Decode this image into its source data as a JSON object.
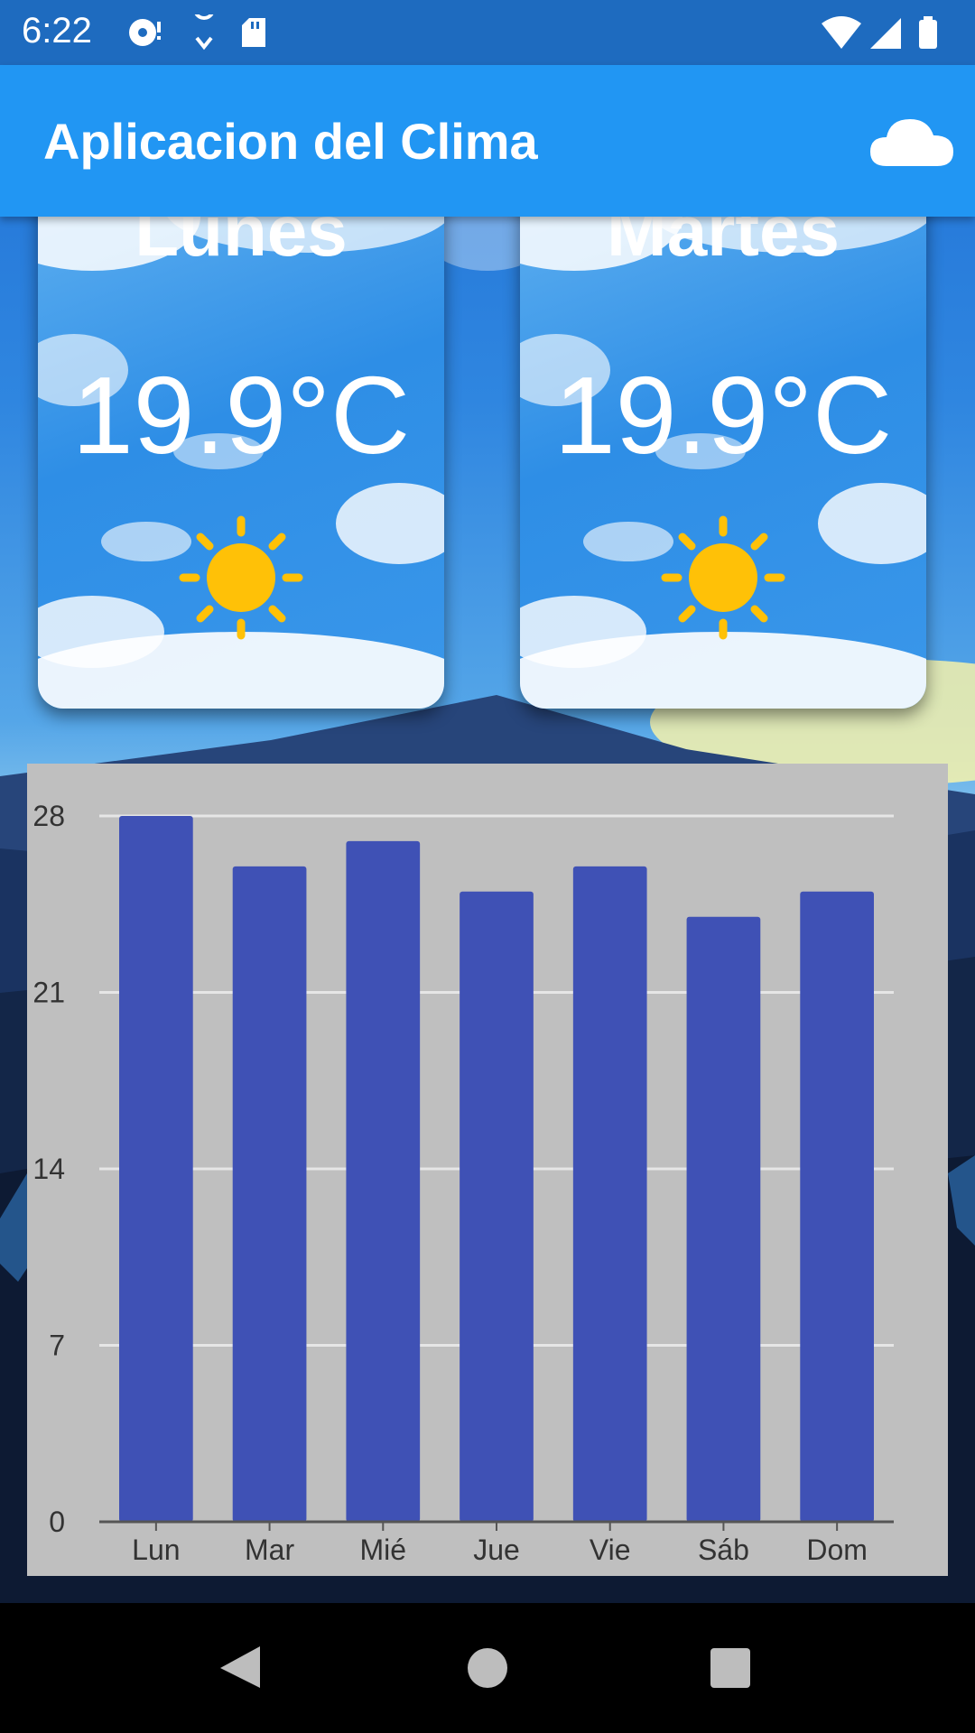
{
  "status_bar": {
    "time": "6:22"
  },
  "app_bar": {
    "title": "Aplicacion del Clima",
    "action_icon": "cloud-icon"
  },
  "cards": [
    {
      "day": "Lunes",
      "temperature": "19.9°C",
      "icon": "sun-icon"
    },
    {
      "day": "Martes",
      "temperature": "19.9°C",
      "icon": "sun-icon"
    }
  ],
  "chart_data": {
    "type": "bar",
    "categories": [
      "Lun",
      "Mar",
      "Mié",
      "Jue",
      "Vie",
      "Sáb",
      "Dom"
    ],
    "values": [
      28,
      26,
      27,
      25,
      26,
      24,
      25
    ],
    "yticks": [
      "0",
      "7",
      "14",
      "21",
      "28"
    ],
    "ylim": [
      0,
      28
    ],
    "grid": true,
    "bar_color": "#3f51b5",
    "title": "",
    "xlabel": "",
    "ylabel": ""
  },
  "colors": {
    "app_bar": "#2196f3",
    "status_bar": "#1e6bbf",
    "sun": "#ffc107",
    "chart_bg": "#bfbfbf"
  },
  "nav_bar": {
    "back_icon": "back-icon",
    "home_icon": "home-icon",
    "recents_icon": "recents-icon"
  }
}
